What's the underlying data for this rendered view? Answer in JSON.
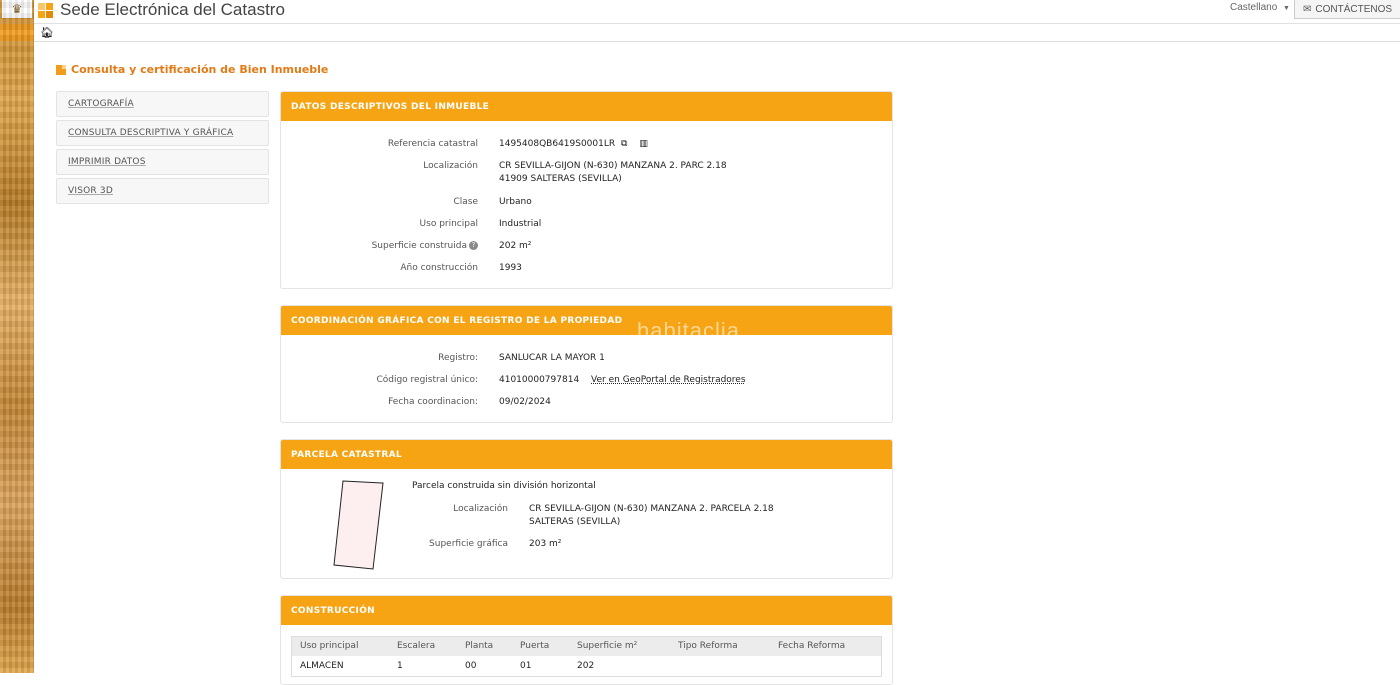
{
  "header": {
    "site_title": "Sede Electrónica del Catastro",
    "language": "Castellano",
    "contact_label": "CONTÁCTENOS"
  },
  "page": {
    "heading": "Consulta y certificación de Bien Inmueble"
  },
  "sidebar": {
    "items": [
      {
        "label": "CARTOGRAFÍA"
      },
      {
        "label": "CONSULTA DESCRIPTIVA Y GRÁFICA"
      },
      {
        "label": "IMPRIMIR DATOS"
      },
      {
        "label": "VISOR 3D"
      }
    ]
  },
  "datos": {
    "title": "DATOS DESCRIPTIVOS DEL INMUEBLE",
    "referencia_label": "Referencia catastral",
    "referencia_value": "1495408QB6419S0001LR",
    "localizacion_label": "Localización",
    "localizacion_line1": "CR SEVILLA-GIJON (N-630) MANZANA 2. PARC 2.18",
    "localizacion_line2": "41909 SALTERAS (SEVILLA)",
    "clase_label": "Clase",
    "clase_value": "Urbano",
    "uso_label": "Uso principal",
    "uso_value": "Industrial",
    "superficie_label": "Superficie construida",
    "superficie_value": "202 m²",
    "anio_label": "Año construcción",
    "anio_value": "1993"
  },
  "coordinacion": {
    "title": "COORDINACIÓN GRÁFICA CON EL REGISTRO DE LA PROPIEDAD",
    "registro_label": "Registro:",
    "registro_value": "SANLUCAR LA MAYOR 1",
    "codigo_label": "Código registral único:",
    "codigo_value": "41010000797814",
    "geoportal_link": "Ver en GeoPortal de Registradores",
    "fecha_label": "Fecha coordinacion:",
    "fecha_value": "09/02/2024"
  },
  "parcela": {
    "title": "PARCELA CATASTRAL",
    "descripcion": "Parcela construida sin división horizontal",
    "localizacion_label": "Localización",
    "localizacion_line1": "CR SEVILLA-GIJON (N-630) MANZANA 2. PARCELA 2.18",
    "localizacion_line2": "SALTERAS (SEVILLA)",
    "superficie_label": "Superficie gráfica",
    "superficie_value": "203 m²"
  },
  "construccion": {
    "title": "CONSTRUCCIÓN",
    "columns": [
      "Uso principal",
      "Escalera",
      "Planta",
      "Puerta",
      "Superficie m²",
      "Tipo Reforma",
      "Fecha Reforma"
    ],
    "rows": [
      [
        "ALMACEN",
        "1",
        "00",
        "01",
        "202",
        "",
        ""
      ]
    ]
  },
  "watermark": "habitaclia",
  "colors": {
    "accent": "#f6a414",
    "heading": "#e27a16"
  }
}
